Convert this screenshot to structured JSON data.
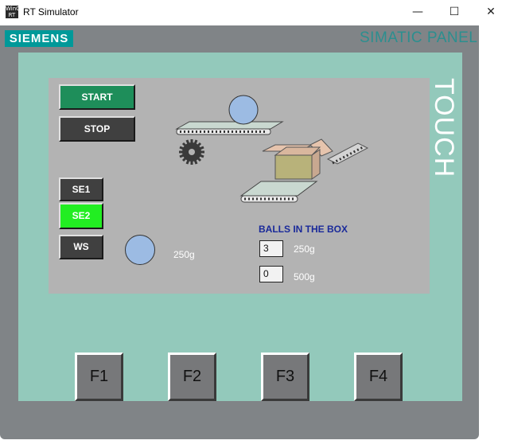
{
  "window": {
    "title": "RT Simulator",
    "icon_text": "WinCC RT",
    "minimize_glyph": "—",
    "maximize_glyph": "☐",
    "close_glyph": "✕"
  },
  "panel": {
    "brand": "SIEMENS",
    "model": "SIMATIC PANEL",
    "side_label": "TOUCH",
    "colors": {
      "frame": "#808487",
      "bezel": "#93c9bb",
      "screen": "#b3b3b3",
      "brand": "#009999"
    }
  },
  "screen": {
    "buttons": {
      "start": "START",
      "stop": "STOP",
      "se1": "SE1",
      "se2": "SE2",
      "ws": "WS"
    },
    "button_colors": {
      "start": "#1e8e5a",
      "stop": "#404040",
      "se2_active": "#22ee22"
    },
    "scale_weight": "250g",
    "balls_title": "BALLS IN THE BOX",
    "counters": [
      {
        "value": "3",
        "label": "250g"
      },
      {
        "value": "0",
        "label": "500g"
      }
    ],
    "icons": [
      "gear-icon",
      "conveyor-icon",
      "ball-icon",
      "box-icon"
    ]
  },
  "function_keys": [
    "F1",
    "F2",
    "F3",
    "F4"
  ]
}
